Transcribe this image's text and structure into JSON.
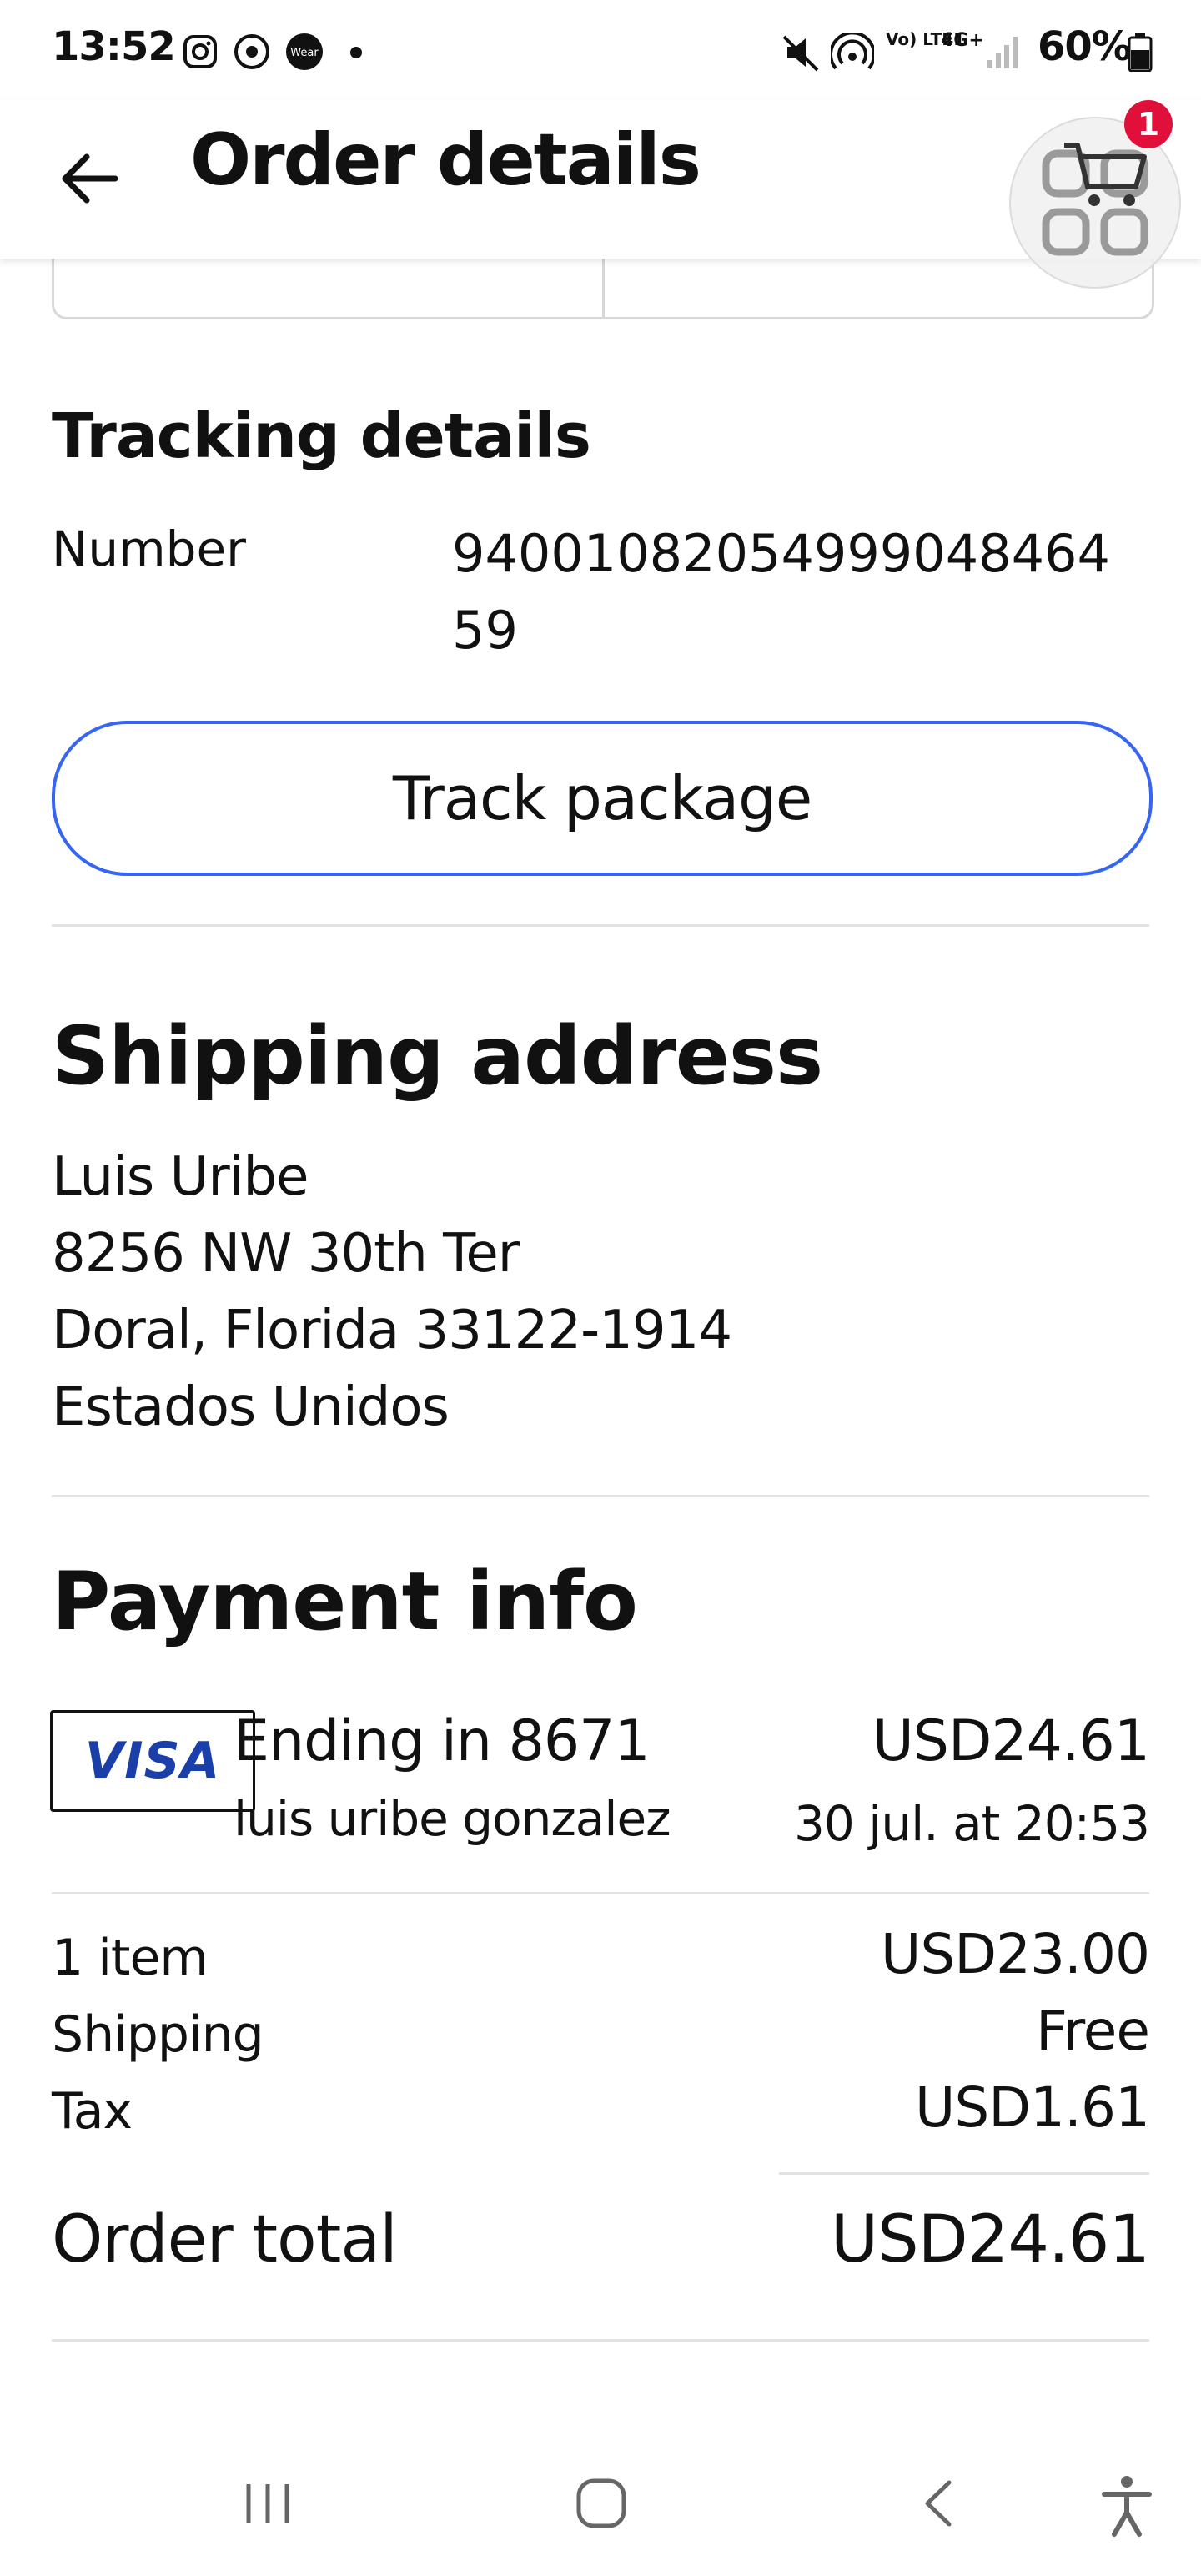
{
  "status_bar": {
    "time": "13:52",
    "battery": "60%",
    "network": "4G+",
    "lte_label": "Vo) LTE1",
    "app_icons": [
      "instagram-icon",
      "chrome-icon",
      "wear-icon"
    ]
  },
  "header": {
    "title": "Order details",
    "cart_count": "1"
  },
  "tracking": {
    "title": "Tracking details",
    "number_label": "Number",
    "number_value": "940010820549990484645 9",
    "number_value_line1": "9400108205499904846 4",
    "track_button": "Track package"
  },
  "shipping": {
    "title": "Shipping address",
    "lines": [
      "Luis Uribe",
      "8256 NW 30th Ter",
      "Doral, Florida 33122-1914",
      "Estados Unidos"
    ]
  },
  "payment": {
    "title": "Payment info",
    "card_brand": "VISA",
    "card_label": "Ending in 8671",
    "card_holder": "luis uribe gonzalez",
    "amount": "USD24.61",
    "date": "30 jul. at 20:53"
  },
  "summary": {
    "rows": [
      {
        "label": "1 item",
        "value": "USD23.00"
      },
      {
        "label": "Shipping",
        "value": "Free"
      },
      {
        "label": "Tax",
        "value": "USD1.61"
      }
    ],
    "total_label": "Order total",
    "total_value": "USD24.61"
  },
  "colors": {
    "accent": "#3665f3",
    "badge": "#e0103a",
    "visa_blue": "#1a3fa8",
    "divider": "#e2e2e2"
  }
}
